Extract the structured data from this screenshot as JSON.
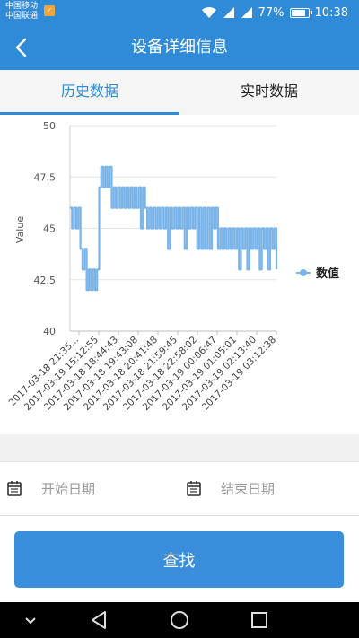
{
  "status_bar": {
    "carrier_1": "中国移动",
    "carrier_2": "中国联通",
    "battery": "77%",
    "time": "10:38",
    "icons": [
      "wifi-icon",
      "signal-icon",
      "signal-icon",
      "battery-icon"
    ]
  },
  "app_bar": {
    "title": "设备详细信息",
    "back_icon": "back-arrow-icon"
  },
  "tabs": [
    {
      "label": "历史数据",
      "active": true
    },
    {
      "label": "实时数据",
      "active": false
    }
  ],
  "chart_data": {
    "type": "line",
    "title": "",
    "xlabel": "",
    "ylabel": "Value",
    "ylim": [
      40,
      50
    ],
    "yticks": [
      "50",
      "47.5",
      "45",
      "42.5",
      "40"
    ],
    "x_tick_labels": [
      "2017-03-18 21:35...",
      "2017-03-19 15:12:55",
      "2017-03-18 18:44:43",
      "2017-03-18 19:43:08",
      "2017-03-18 20:41:48",
      "2017-03-18 21:59:45",
      "2017-03-18 22:58:02",
      "2017-03-19 00:06:47",
      "2017-03-19 01:05:01",
      "2017-03-19 02:13:40",
      "2017-03-19 03:12:38"
    ],
    "series": [
      {
        "name": "数值",
        "color": "#7ab4e8",
        "values": [
          46,
          45,
          46,
          45,
          46,
          44,
          43,
          44,
          42,
          43,
          42,
          43,
          42,
          43,
          47,
          48,
          47,
          48,
          47,
          48,
          46,
          47,
          46,
          47,
          46,
          47,
          46,
          47,
          46,
          47,
          46,
          47,
          46,
          47,
          45,
          47,
          46,
          45,
          46,
          45,
          46,
          45,
          46,
          45,
          46,
          45,
          46,
          44,
          46,
          45,
          46,
          45,
          46,
          45,
          46,
          44,
          46,
          45,
          46,
          45,
          46,
          44,
          46,
          44,
          46,
          44,
          46,
          44,
          46,
          45,
          46,
          44,
          45,
          44,
          45,
          44,
          45,
          44,
          45,
          44,
          45,
          43,
          45,
          44,
          45,
          43,
          45,
          44,
          45,
          44,
          45,
          43,
          45,
          44,
          45,
          43,
          45,
          44,
          45,
          43
        ]
      }
    ],
    "legend": {
      "position": "right",
      "label": "数值"
    },
    "grid": true
  },
  "filters": {
    "start_date_placeholder": "开始日期",
    "end_date_placeholder": "结束日期",
    "calendar_icon": "calendar-icon"
  },
  "actions": {
    "search_label": "查找"
  },
  "nav_bar": {
    "icons": [
      "hide-keyboard-icon",
      "back-icon",
      "home-icon",
      "recents-icon"
    ]
  }
}
